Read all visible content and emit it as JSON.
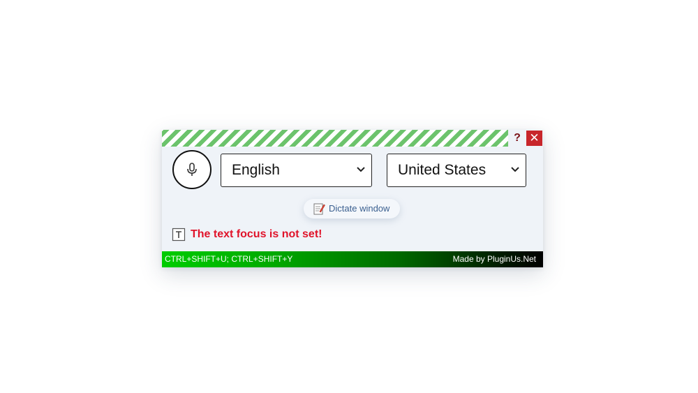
{
  "titlebar": {
    "help_label": "?",
    "close_label": "✕"
  },
  "controls": {
    "language_selected": "English",
    "region_selected": "United States"
  },
  "dictate": {
    "label": "Dictate window"
  },
  "status": {
    "text": "The text focus is not set!"
  },
  "footer": {
    "shortcuts": "CTRL+SHIFT+U; CTRL+SHIFT+Y",
    "credit": "Made by PluginUs.Net"
  },
  "icons": {
    "mic": "microphone-icon",
    "chevron": "chevron-down-icon",
    "dictate": "notepad-pencil-icon",
    "focus": "text-field-icon"
  },
  "colors": {
    "stripe_green": "#6cc36c",
    "close_red": "#c8262b",
    "status_red": "#e0132a",
    "footer_green": "#00cc00",
    "link_blue": "#3a5f8f"
  }
}
